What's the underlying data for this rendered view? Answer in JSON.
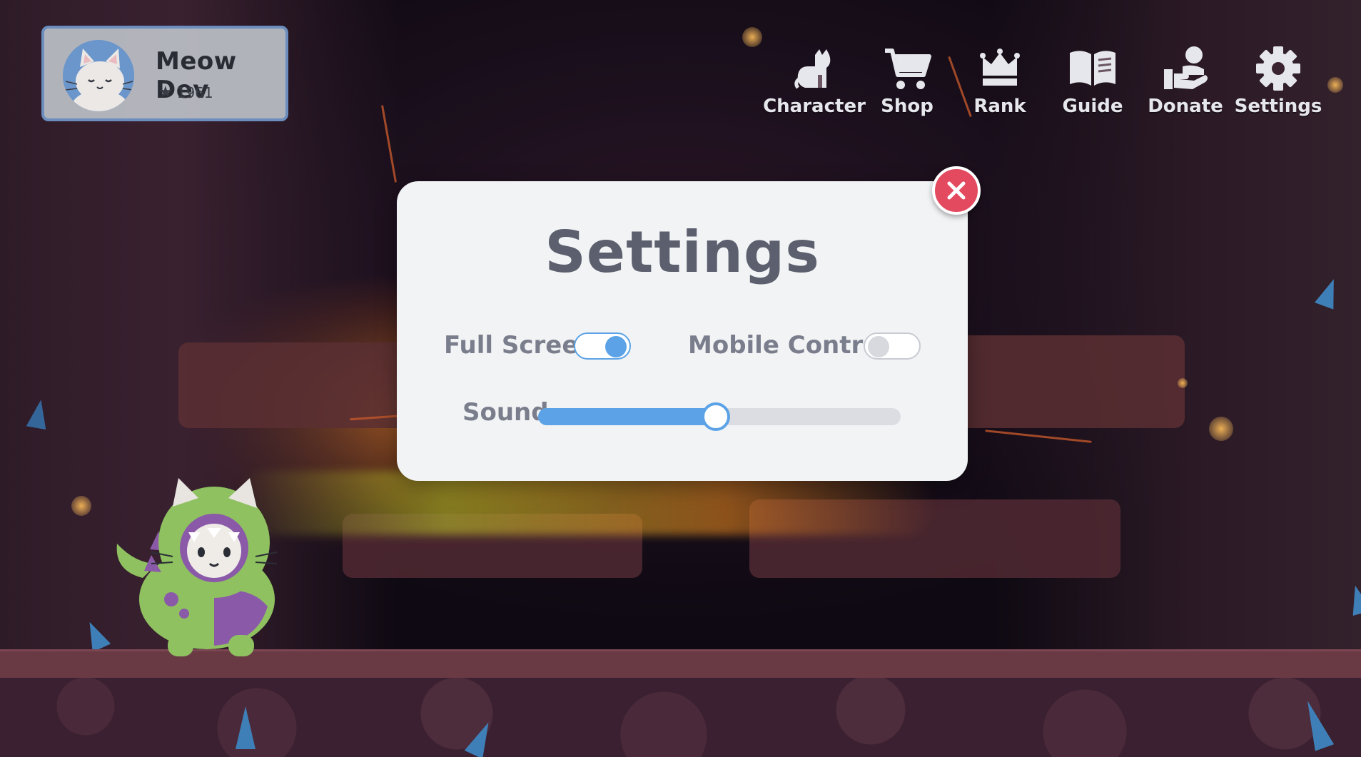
{
  "profile": {
    "name": "Meow Dev",
    "score": "1961",
    "avatar_icon": "white-cat-avatar-icon",
    "score_icon": "star-trophy-icon"
  },
  "nav": {
    "items": [
      {
        "label": "Character",
        "icon": "cat-icon"
      },
      {
        "label": "Shop",
        "icon": "shopping-cart-icon"
      },
      {
        "label": "Rank",
        "icon": "crown-icon"
      },
      {
        "label": "Guide",
        "icon": "book-icon"
      },
      {
        "label": "Donate",
        "icon": "donate-hand-icon"
      },
      {
        "label": "Settings",
        "icon": "gear-icon"
      }
    ]
  },
  "settings_modal": {
    "title": "Settings",
    "full_screen": {
      "label": "Full Screen",
      "enabled": true
    },
    "mobile_control": {
      "label": "Mobile Control",
      "enabled": false
    },
    "sound": {
      "label": "Sound",
      "level": 0.49
    },
    "close_icon": "close-icon"
  },
  "colors": {
    "accent": "#5ba3e6",
    "close_button": "#e34a5f",
    "modal_background": "#f2f3f5",
    "title_text": "#5c5f6e",
    "label_text": "#7a7e8c",
    "profile_border": "#6e93c5"
  }
}
